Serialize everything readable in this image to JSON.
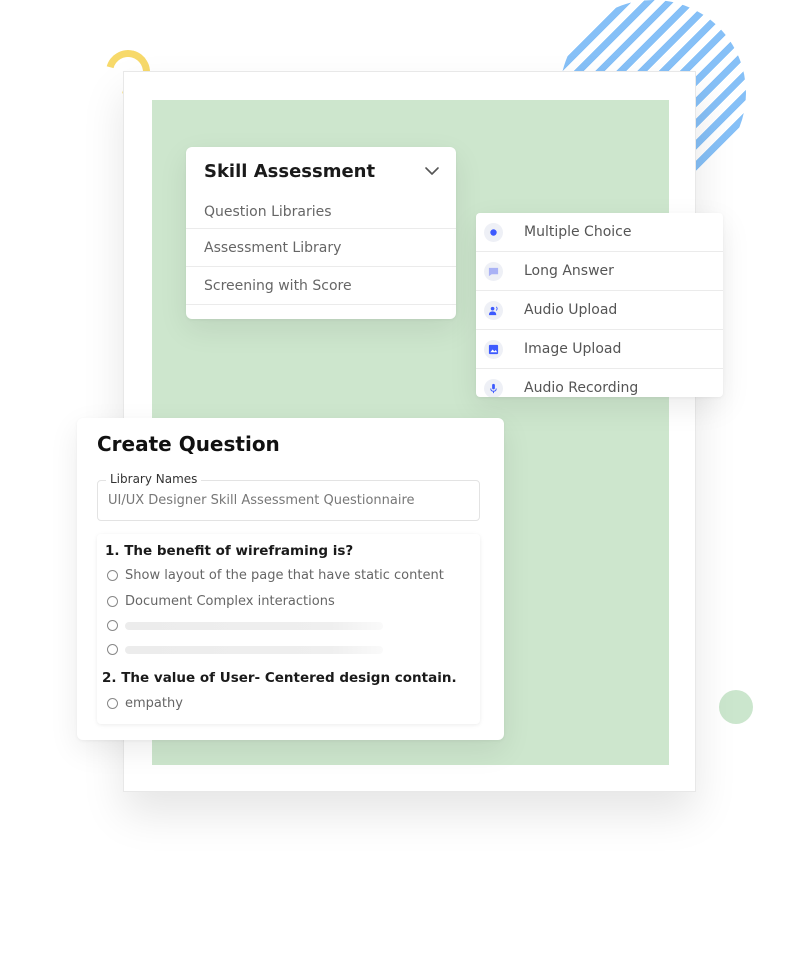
{
  "skill_menu": {
    "title": "Skill Assessment",
    "items": [
      {
        "label": "Question Libraries"
      },
      {
        "label": "Assessment Library"
      },
      {
        "label": "Screening with Score"
      }
    ]
  },
  "question_types": [
    {
      "label": "Multiple Choice",
      "icon": "radio-icon"
    },
    {
      "label": "Long Answer",
      "icon": "comment-icon"
    },
    {
      "label": "Audio Upload",
      "icon": "voice-user-icon"
    },
    {
      "label": "Image Upload",
      "icon": "image-icon"
    },
    {
      "label": "Audio Recording",
      "icon": "microphone-icon"
    }
  ],
  "create_question": {
    "title": "Create Question",
    "library_field": {
      "label": "Library Names",
      "value": "UI/UX Designer Skill Assessment Questionnaire"
    },
    "questions": [
      {
        "title": "1. The benefit of wireframing is?",
        "options": [
          "Show layout of the page that have static content",
          "Document Complex interactions",
          "",
          ""
        ]
      },
      {
        "title": "2. The value of User- Centered design contain.",
        "options": [
          "empathy"
        ]
      }
    ]
  },
  "colors": {
    "accent": "#3d5afe",
    "panel_green": "#cde6cd",
    "stripe_blue": "#86c0f7",
    "ring_yellow": "#f7d96a"
  }
}
